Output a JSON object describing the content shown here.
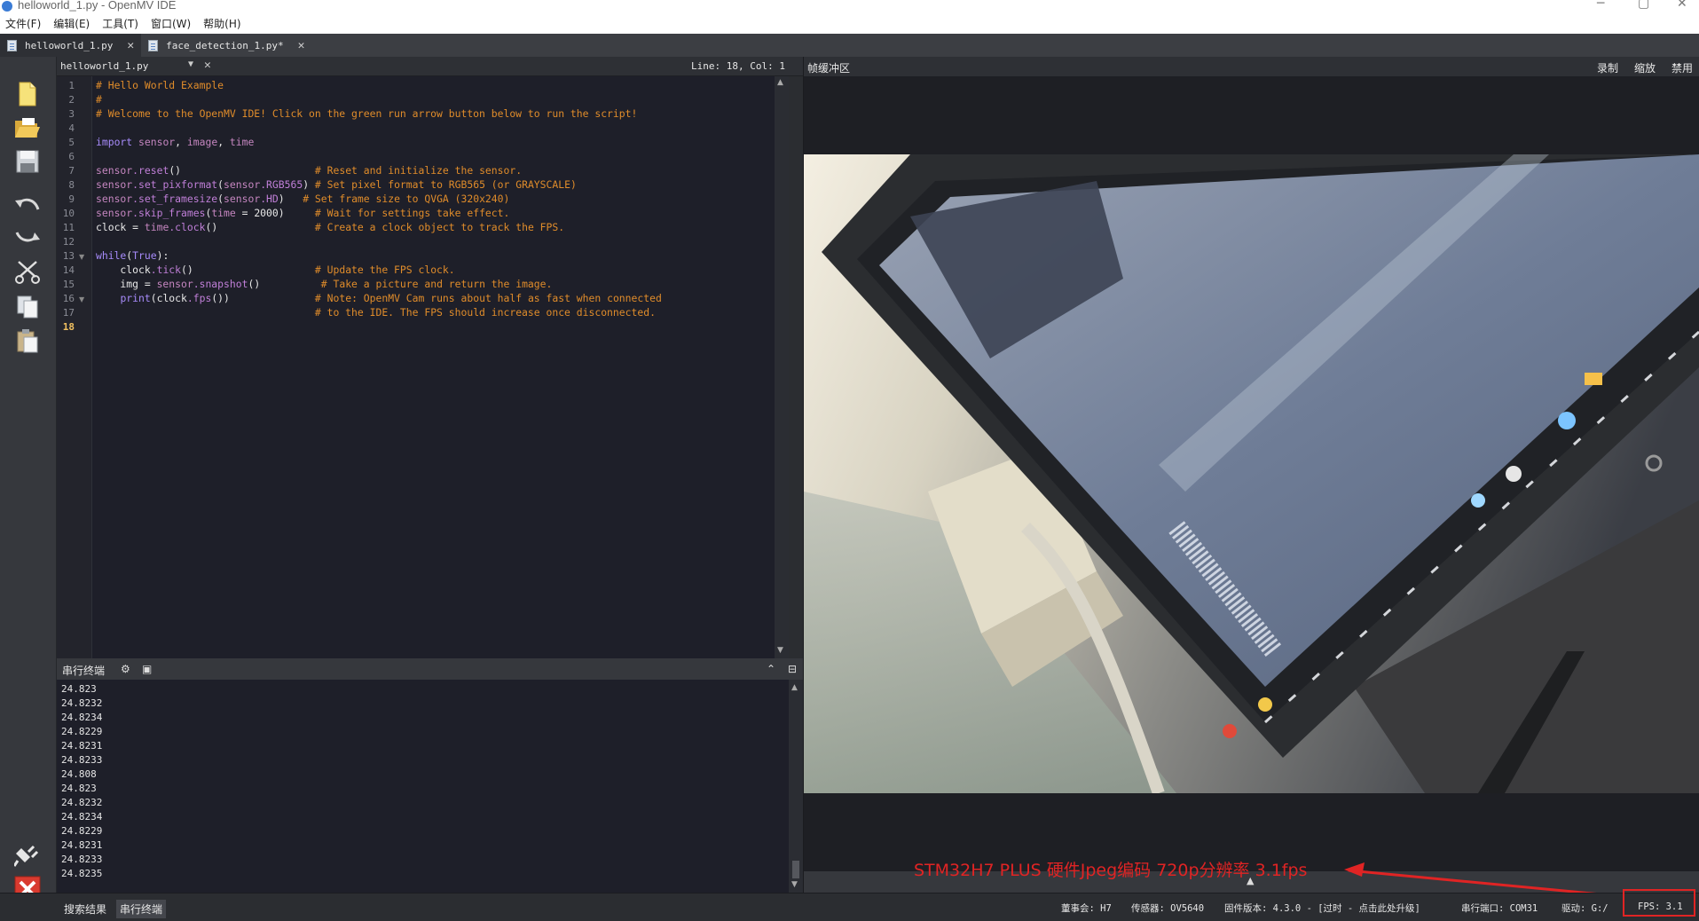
{
  "window": {
    "title": "helloworld_1.py - OpenMV IDE"
  },
  "menu": [
    "文件(F)",
    "编辑(E)",
    "工具(T)",
    "窗口(W)",
    "帮助(H)"
  ],
  "tabs": [
    {
      "label": "helloworld_1.py"
    },
    {
      "label": "face_detection_1.py*"
    }
  ],
  "editor": {
    "file": "helloworld_1.py",
    "position": "Line: 18, Col: 1",
    "current_line": "18"
  },
  "terminal": {
    "title": "串行终端",
    "lines": [
      "24.823",
      "24.8232",
      "24.8234",
      "24.8229",
      "24.8231",
      "24.8233",
      "24.808",
      "24.823",
      "24.8232",
      "24.8234",
      "24.8229",
      "24.8231",
      "24.8233",
      "24.8235"
    ]
  },
  "framebuffer": {
    "title": "帧缓冲区",
    "actions": [
      "录制",
      "缩放",
      "禁用"
    ]
  },
  "annotation": {
    "text": "STM32H7 PLUS  硬件Jpeg编码 720p分辨率  3.1fps"
  },
  "status": {
    "tabs": [
      "搜索结果",
      "串行终端"
    ],
    "board": "董事会: H7",
    "sensor": "传感器: OV5640",
    "firmware": "固件版本: 4.3.0 - [过时 - 点击此处升级]",
    "port": "串行端口: COM31",
    "drive": "驱动: G:/",
    "fps": "FPS:   3.1"
  },
  "colors": {
    "comment": "#e08c2a",
    "keyword": "#a78bfa",
    "annotation": "#e02424",
    "editor_bg": "#1e1f29"
  }
}
